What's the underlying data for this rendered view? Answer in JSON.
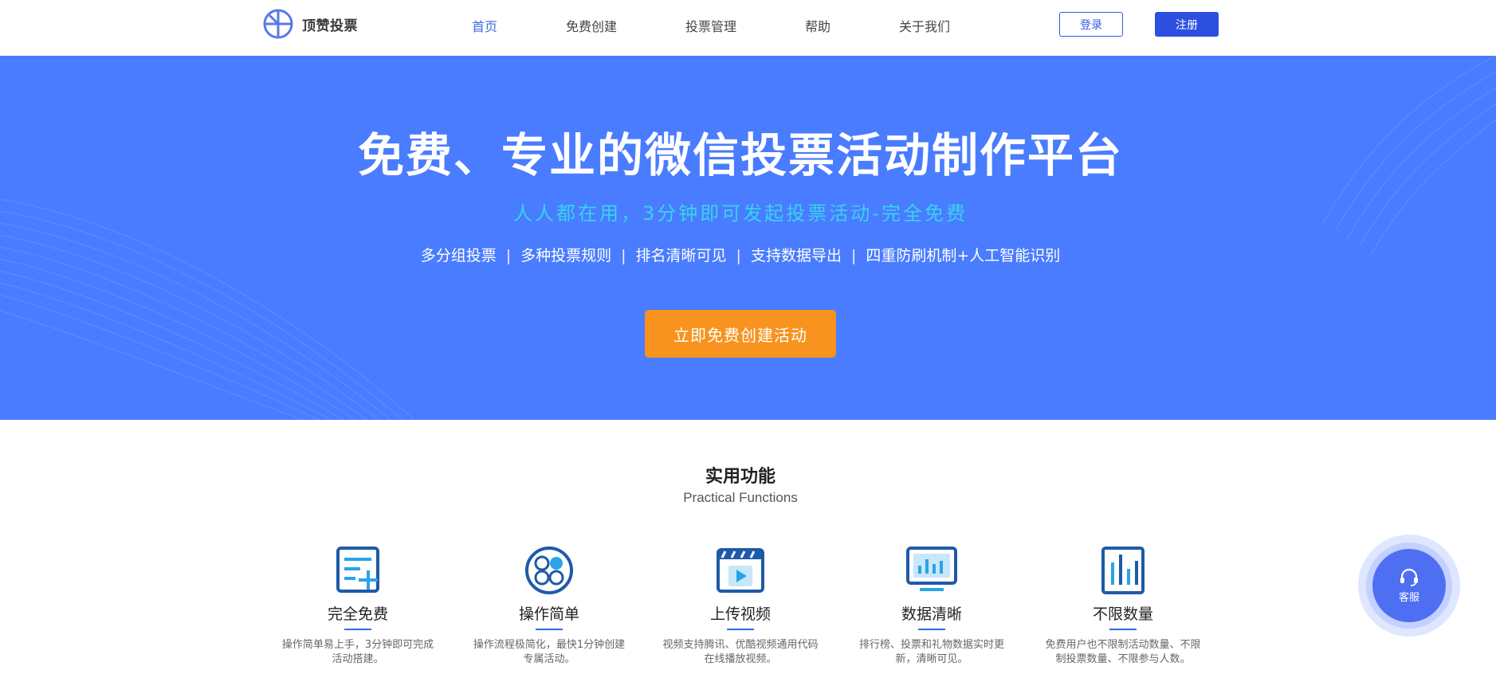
{
  "header": {
    "logo_text": "顶赞投票",
    "nav": [
      {
        "label": "首页",
        "active": true
      },
      {
        "label": "免费创建",
        "active": false
      },
      {
        "label": "投票管理",
        "active": false
      },
      {
        "label": "帮助",
        "active": false
      },
      {
        "label": "关于我们",
        "active": false
      }
    ],
    "login_label": "登录",
    "register_label": "注册"
  },
  "hero": {
    "title": "免费、专业的微信投票活动制作平台",
    "subtitle": "人人都在用，3分钟即可发起投票活动-完全免费",
    "features": [
      "多分组投票",
      "多种投票规则",
      "排名清晰可见",
      "支持数据导出",
      "四重防刷机制+人工智能识别"
    ],
    "separator": "|",
    "cta_label": "立即免费创建活动"
  },
  "functions": {
    "title": "实用功能",
    "subtitle": "Practical Functions",
    "items": [
      {
        "icon": "form-plus-icon",
        "title": "完全免费",
        "desc": "操作简单易上手，3分钟即可完成活动搭建。"
      },
      {
        "icon": "circles-grid-icon",
        "title": "操作简单",
        "desc": "操作流程极简化，最快1分钟创建专属活动。"
      },
      {
        "icon": "video-clapper-icon",
        "title": "上传视频",
        "desc": "视频支持腾讯、优酷视频通用代码在线播放视频。"
      },
      {
        "icon": "bar-chart-monitor-icon",
        "title": "数据清晰",
        "desc": "排行榜、投票和礼物数据实时更新，清晰可见。"
      },
      {
        "icon": "bar-chart-box-icon",
        "title": "不限数量",
        "desc": "免费用户也不限制活动数量、不限制投票数量、不限参与人数。"
      }
    ]
  },
  "customer_service": {
    "label": "客服",
    "icon": "headset-icon"
  },
  "colors": {
    "hero_bg": "#4a7cff",
    "accent": "#3a57e8",
    "cta": "#f7931e",
    "subtitle": "#36d3ee"
  }
}
